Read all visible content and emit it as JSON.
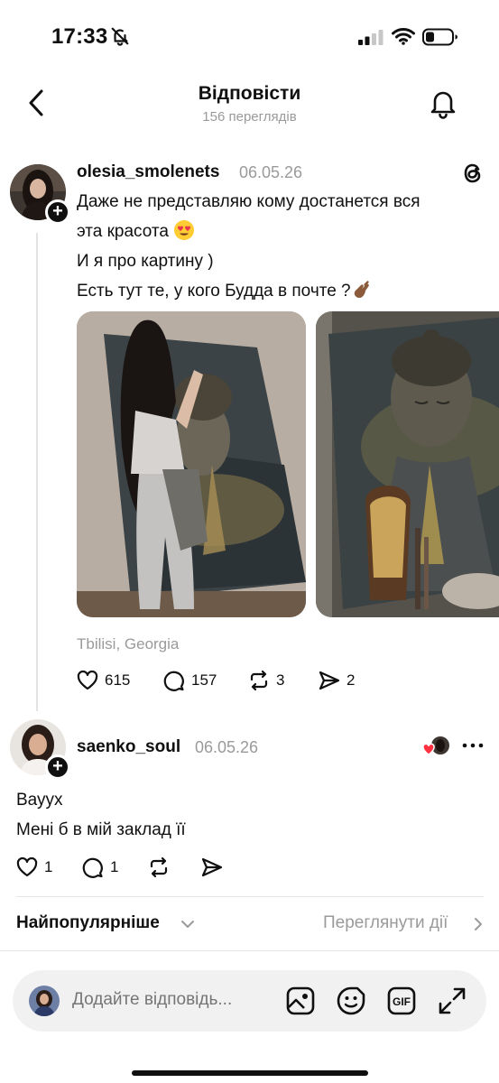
{
  "status_bar": {
    "time": "17:33",
    "icons": [
      "bell-off-icon",
      "signal-icon",
      "wifi-icon",
      "battery-icon"
    ]
  },
  "header": {
    "title": "Відповісти",
    "subtitle": "156 переглядів",
    "icons": [
      "back-icon",
      "bell-icon"
    ]
  },
  "post": {
    "username": "olesia_smolenets",
    "date": "06.05.26",
    "lines": [
      "Даже не представляю кому достанется вся",
      "эта красота",
      "И я про картину )",
      "Есть тут те, у кого Будда в почте ?"
    ],
    "location": "Tbilisi, Georgia",
    "likes": "615",
    "replies": "157",
    "reposts": "3",
    "shares": "2",
    "photos": [
      "woman-painting-buddha-photo",
      "buddha-painting-closeup-photo"
    ]
  },
  "reply": {
    "username": "saenko_soul",
    "date": "06.05.26",
    "lines": [
      "Вауух",
      "Мені б в мій заклад її"
    ],
    "likes": "1",
    "replies": "1"
  },
  "sort": {
    "label": "Найпопулярніше",
    "view_activity": "Переглянути дії"
  },
  "composer": {
    "placeholder": "Додайте відповідь...",
    "buttons": [
      "image-icon",
      "sticker-icon",
      "gif-icon",
      "expand-icon"
    ]
  },
  "colors": {
    "text": "#101010",
    "muted": "#9a9a9a",
    "composer_bg": "#f1f1f1",
    "divider": "#e6e6e6",
    "like_red": "#ff3040"
  }
}
